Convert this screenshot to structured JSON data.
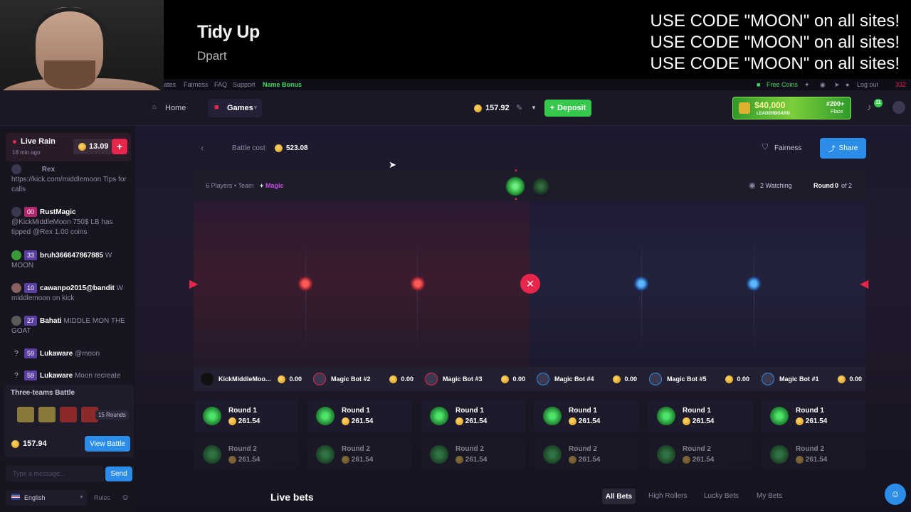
{
  "stream_overlay": {
    "song_title": "Tidy Up",
    "song_artist": "Dpart",
    "promo_lines": [
      "USE CODE \"MOON\" on all sites!",
      "USE CODE \"MOON\" on all sites!",
      "USE CODE \"MOON\" on all sites!"
    ]
  },
  "topnav": {
    "items": [
      "ates",
      "Fairness",
      "FAQ",
      "Support"
    ],
    "name_bonus": "Name Bonus",
    "free_coins": "Free Coins",
    "logout": "Log out",
    "count": "332"
  },
  "mainnav": {
    "home": "Home",
    "games": "Games",
    "balance": "157.92",
    "deposit": "Deposit",
    "leaderboard_amount": "$40,000",
    "leaderboard_label": "LEADERBOARD",
    "place": "#200+",
    "place_label": "Place",
    "notif_count": "11"
  },
  "sidebar": {
    "live_rain_title": "Live Rain",
    "live_rain_time": "18 min ago",
    "live_rain_amount": "13.09",
    "chat": [
      {
        "user": "Rex",
        "level": "",
        "text": "https://kick.com/middlemoon Tips for calls"
      },
      {
        "user": "RustMagic",
        "level": "00",
        "text": "@KickMiddleMoon 750$ LB has tipped @Rex 1.00 coins"
      },
      {
        "user": "bruh366647867885",
        "level": "33",
        "text": "W MOON"
      },
      {
        "user": "cawanpo2015@bandit",
        "level": "10",
        "text": "W middlemoon on kick"
      },
      {
        "user": "Bahati",
        "level": "27",
        "text": "MIDDLE MON THE GOAT"
      },
      {
        "user": "Lukaware",
        "level": "59",
        "text": "@moon"
      },
      {
        "user": "Lukaware",
        "level": "59",
        "text": "Moon recreate"
      }
    ],
    "battle_card_title": "Three-teams Battle",
    "battle_card_rounds": "15 Rounds",
    "battle_card_cost": "157.94",
    "view_battle": "View Battle",
    "message_placeholder": "Type a message...",
    "send": "Send",
    "language": "English",
    "rules": "Rules"
  },
  "battle": {
    "back_icon": "chevron-left-icon",
    "cost_label": "Battle cost",
    "cost_value": "523.08",
    "fairness": "Fairness",
    "share": "Share",
    "players_info": "6 Players • Team",
    "plus": "+",
    "magic": "Magic",
    "watching": "2 Watching",
    "round_label": "Round",
    "round_current": "0",
    "round_of": "of 2",
    "players": [
      {
        "name": "KickMiddleMoo...",
        "value": "0.00"
      },
      {
        "name": "Magic Bot #2",
        "value": "0.00"
      },
      {
        "name": "Magic Bot #3",
        "value": "0.00"
      },
      {
        "name": "Magic Bot #4",
        "value": "0.00"
      },
      {
        "name": "Magic Bot #5",
        "value": "0.00"
      },
      {
        "name": "Magic Bot #1",
        "value": "0.00"
      }
    ],
    "round1_label": "Round 1",
    "round2_label": "Round 2",
    "round_value": "261.54"
  },
  "live_bets": {
    "title": "Live bets",
    "tabs": [
      "All Bets",
      "High Rollers",
      "Lucky Bets",
      "My Bets"
    ]
  },
  "colors": {
    "accent_red": "#e8254a",
    "accent_blue": "#2b8de8",
    "accent_green": "#34c94a",
    "magic_purple": "#c44ce0"
  }
}
